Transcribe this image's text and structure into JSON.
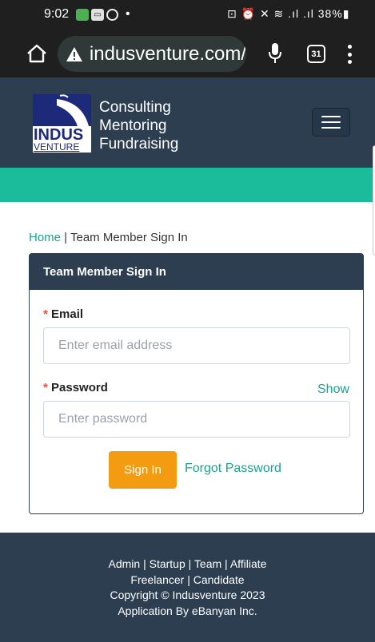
{
  "status_bar": {
    "time": "9:02",
    "dot": "•",
    "right_text": "⊡ ⏰ ✕ ≋ .ıl .ıl 38%▮"
  },
  "browser": {
    "url": "indusventure.com/",
    "tab_count": "31"
  },
  "header": {
    "logo_line1": "INDUS",
    "logo_line2": "VENTURE",
    "tagline_1": "Consulting",
    "tagline_2": "Mentoring",
    "tagline_3": "Fundraising"
  },
  "breadcrumb": {
    "home": "Home",
    "separator": " | ",
    "current": "Team Member Sign In"
  },
  "form": {
    "title": "Team Member Sign In",
    "required_mark": "* ",
    "email_label": "Email",
    "email_placeholder": "Enter email address",
    "password_label": "Password",
    "show_label": "Show",
    "password_placeholder": "Enter password",
    "signin_label": "Sign In",
    "forgot_label": "Forgot Password"
  },
  "footer": {
    "links_row1": [
      "Admin",
      "Startup",
      "Team",
      "Affiliate"
    ],
    "links_row2": [
      "Freelancer",
      "Candidate"
    ],
    "sep": " | ",
    "copyright": "Copyright © Indusventure 2023",
    "credit": "Application By eBanyan Inc."
  },
  "colors": {
    "navy": "#2c3e50",
    "teal": "#1abc9c",
    "link": "#1aa38c",
    "orange": "#f39c12",
    "required": "#e74c3c"
  },
  "icons": [
    "home-icon",
    "warning-icon",
    "mic-icon",
    "tabs-icon",
    "menu-dots-icon",
    "hamburger-icon"
  ]
}
